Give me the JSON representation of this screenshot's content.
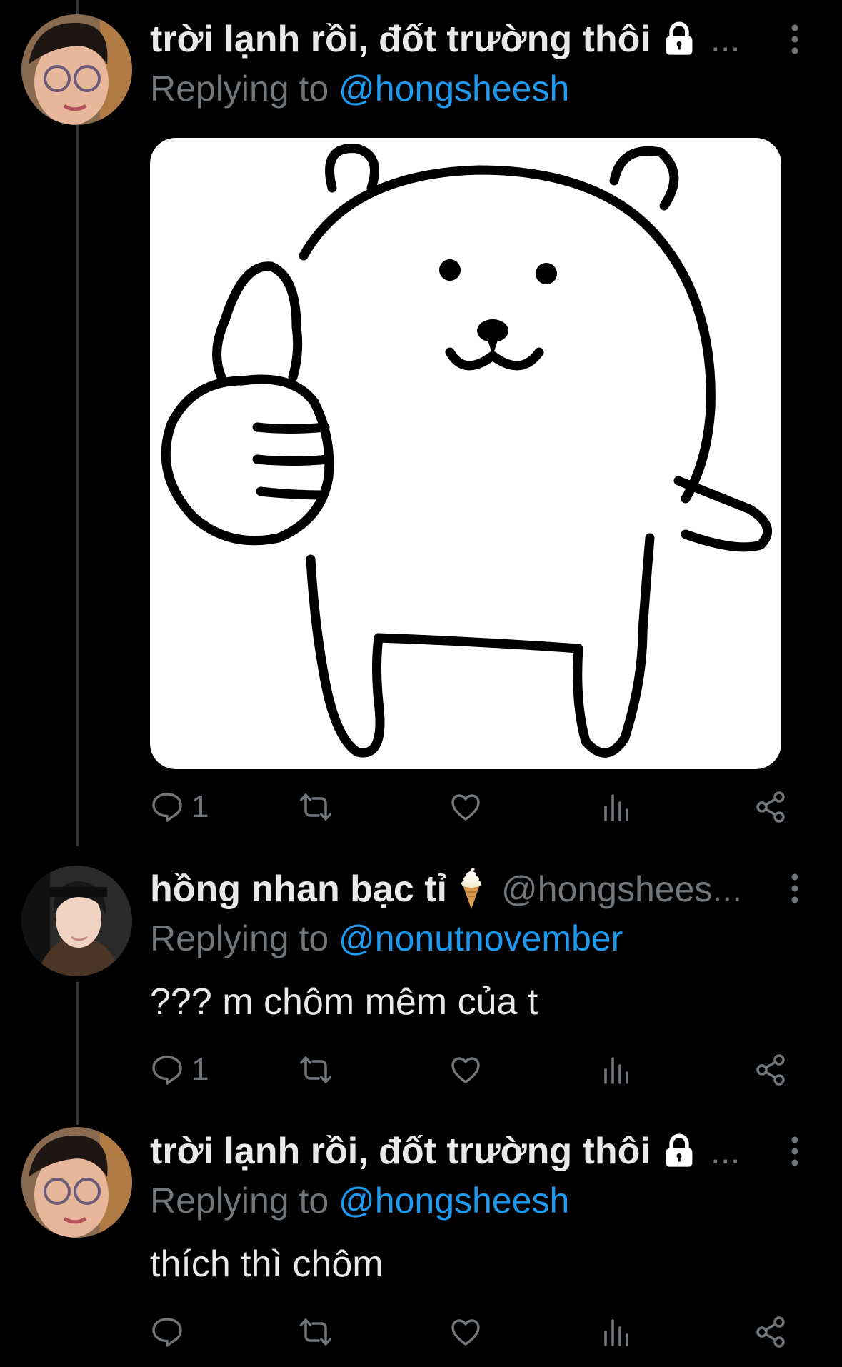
{
  "tweets": [
    {
      "display_name": "trời lạnh rồi, đốt trường thôi",
      "handle_truncated": "...",
      "reply_prefix": "Replying to ",
      "reply_to": "@hongsheesh",
      "text": "",
      "has_media": true,
      "reply_count": "1"
    },
    {
      "display_name": "hồng nhan bạc tỉ",
      "handle_truncated": "@hongshees...",
      "reply_prefix": "Replying to ",
      "reply_to": "@nonutnovember",
      "text": "??? m chôm mêm của t",
      "reply_count": "1"
    },
    {
      "display_name": "trời lạnh rồi, đốt trường thôi",
      "handle_truncated": "...",
      "reply_prefix": "Replying to ",
      "reply_to": "@hongsheesh",
      "text": "thích thì chôm",
      "reply_count": ""
    }
  ],
  "icons": {
    "lock": "lock-icon",
    "ice_cream": "ice-cream-emoji-icon",
    "more": "more-vertical-icon",
    "reply": "reply-icon",
    "retweet": "retweet-icon",
    "like": "heart-icon",
    "views": "analytics-icon",
    "share": "share-icon"
  },
  "colors": {
    "background": "#000000",
    "text": "#e7e9ea",
    "muted": "#71767b",
    "link": "#1d9bf0"
  }
}
